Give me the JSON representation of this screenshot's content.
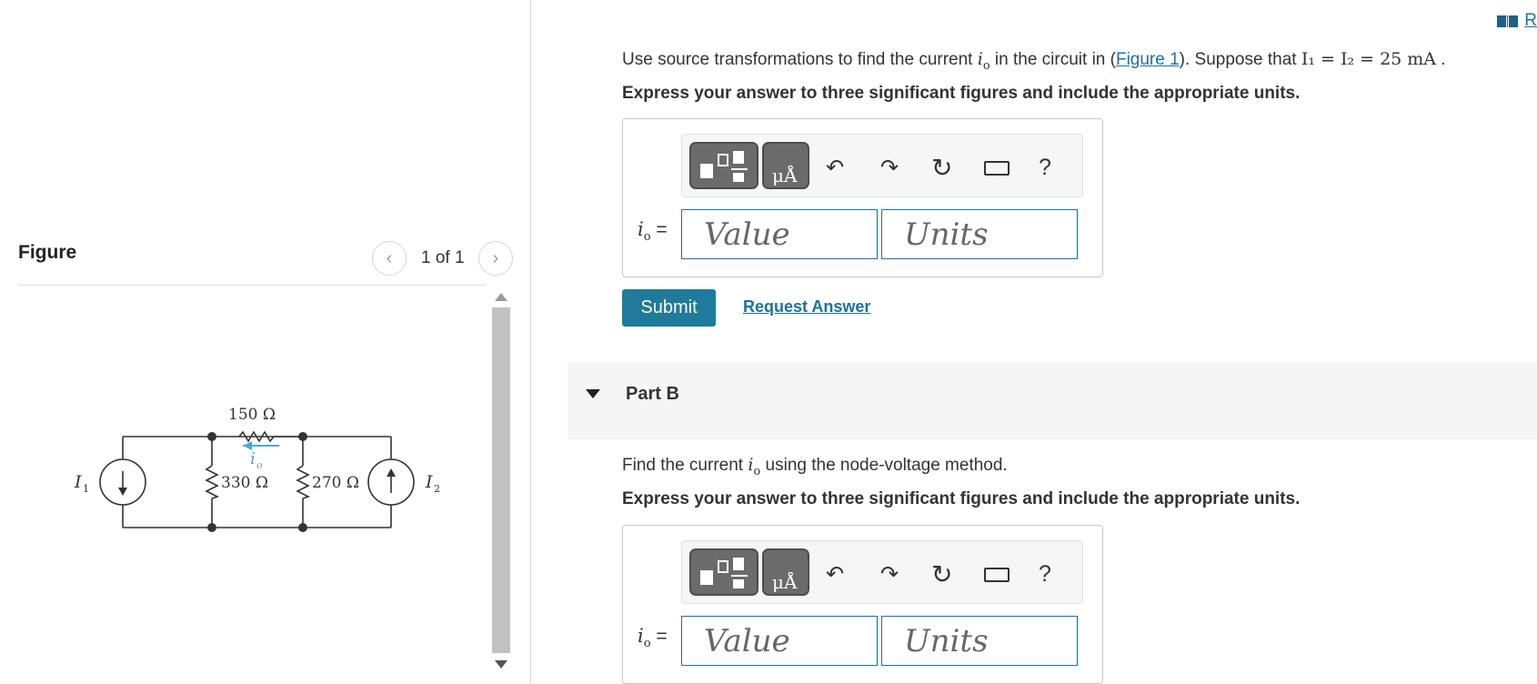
{
  "figure": {
    "title": "Figure",
    "pager": "1 of 1"
  },
  "circuit": {
    "source_left": "I",
    "source_left_sub": "1",
    "source_right": "I",
    "source_right_sub": "2",
    "r_top": "150 Ω",
    "r_mid1": "330 Ω",
    "r_mid2": "270 Ω",
    "current_label": "i",
    "current_label_sub": "o"
  },
  "header": {
    "link_label": "R"
  },
  "partA": {
    "prompt_pre": "Use source transformations to find the current ",
    "prompt_var": "i",
    "prompt_var_sub": "o",
    "prompt_mid": " in the circuit in (",
    "figure_link": "Figure 1",
    "prompt_post": "). Suppose that ",
    "condition": "I₁ = I₂ = 25 mA",
    "prompt_end": " .",
    "instruction": "Express your answer to three significant figures and include the appropriate units.",
    "eq_label": "i",
    "eq_label_sub": "o",
    "eq_sign": " =",
    "value_placeholder": "Value",
    "units_placeholder": "Units",
    "help": "?",
    "submit": "Submit",
    "request_answer": "Request Answer"
  },
  "partB": {
    "title": "Part B",
    "prompt_pre": "Find the current ",
    "prompt_var": "i",
    "prompt_var_sub": "o",
    "prompt_post": " using the node-voltage method.",
    "instruction": "Express your answer to three significant figures and include the appropriate units.",
    "eq_label": "i",
    "eq_label_sub": "o",
    "eq_sign": " =",
    "value_placeholder": "Value",
    "units_placeholder": "Units",
    "help": "?"
  },
  "colors": {
    "accent": "#1f7a9c",
    "link": "#1a73a8",
    "toolbar_button": "#6b6b6b"
  }
}
